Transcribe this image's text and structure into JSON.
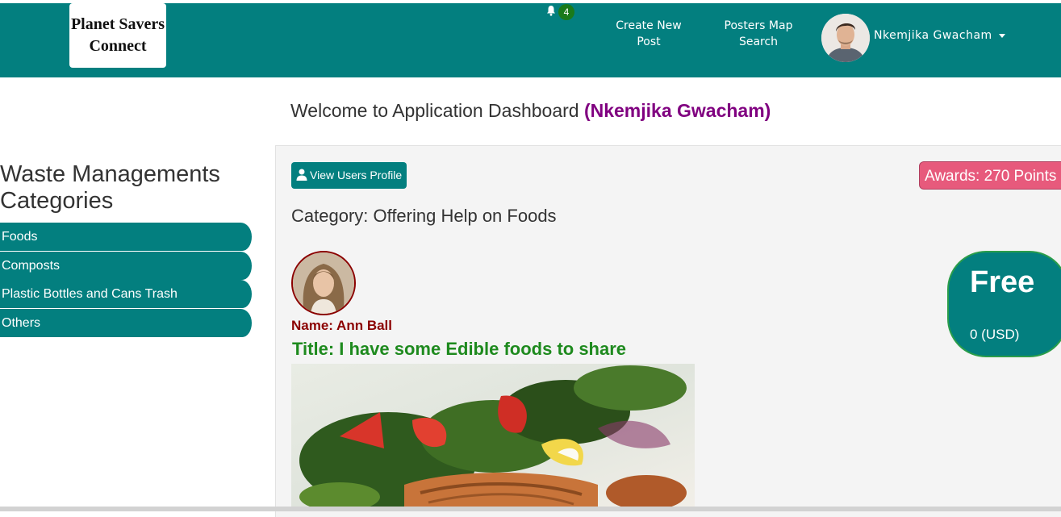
{
  "brand": {
    "line1": "Planet Savers",
    "line2": "Connect"
  },
  "notifications": {
    "count": "4"
  },
  "nav": {
    "create_post": "Create New Post",
    "posters_map_line1": "Posters Map",
    "posters_map_line2": "Search"
  },
  "user": {
    "name": "Nkemjika Gwacham"
  },
  "welcome": {
    "text": "Welcome to Application Dashboard",
    "name": "(Nkemjika Gwacham)"
  },
  "sidebar": {
    "heading_line1": "Waste Managements",
    "heading_line2": "Categories",
    "items": [
      {
        "label": "Foods"
      },
      {
        "label": "Composts"
      },
      {
        "label": "Plastic Bottles and Cans Trash"
      },
      {
        "label": "Others"
      }
    ]
  },
  "main": {
    "profile_button": "View Users Profile",
    "awards": "Awards: 270 Points",
    "category": "Category: Offering Help on Foods",
    "post": {
      "poster_name": "Name: Ann Ball",
      "title": "Title: I have some Edible foods to share",
      "price_label": "Free",
      "price_usd": "0 (USD)"
    }
  },
  "colors": {
    "primary": "#037f7f",
    "accent_purple": "#800080",
    "awards_pink": "#e75a7c",
    "title_green": "#1e8a1e",
    "name_maroon": "#8b0000"
  },
  "icons": {
    "notification": "bell-icon",
    "profile": "user-icon",
    "menu": "caret-down-icon"
  }
}
